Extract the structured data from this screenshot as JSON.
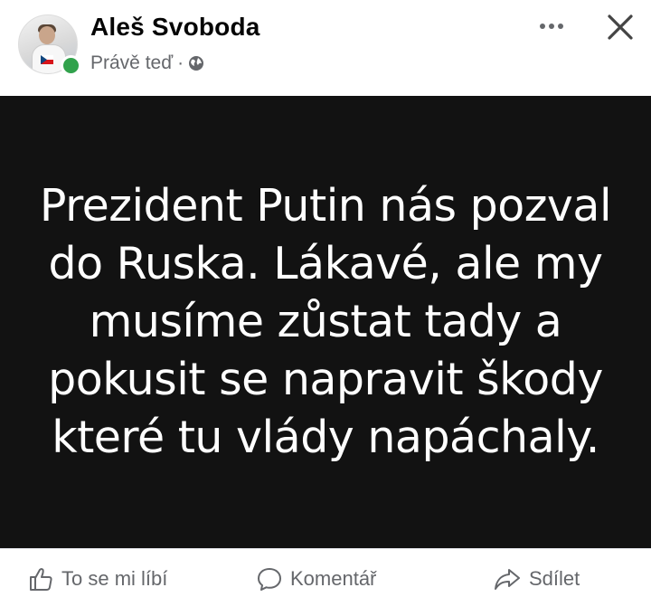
{
  "post": {
    "author": "Aleš Svoboda",
    "timestamp": "Právě teď",
    "separator": "·",
    "privacy_icon": "globe-icon",
    "online_status_color": "#31a24c",
    "image_text": "Prezident Putin nás pozval do Ruska. Lákavé, ale my musíme zůstat tady a pokusit se napravit škody které tu vlády napáchaly.",
    "image_background": "#121212"
  },
  "header": {
    "more_icon": "more-options-icon",
    "close_icon": "close-icon"
  },
  "actions": {
    "like_label": "To se mi líbí",
    "comment_label": "Komentář",
    "share_label": "Sdílet"
  }
}
